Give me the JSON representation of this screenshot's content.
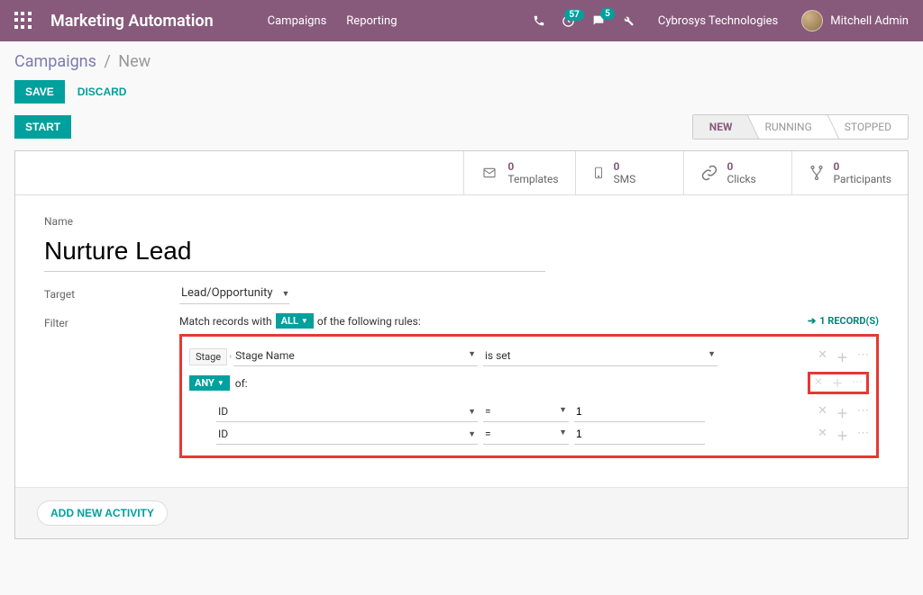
{
  "header": {
    "app_title": "Marketing Automation",
    "nav": {
      "campaigns": "Campaigns",
      "reporting": "Reporting"
    },
    "badges": {
      "activities": "57",
      "messages": "5"
    },
    "company": "Cybrosys Technologies",
    "user": "Mitchell Admin"
  },
  "breadcrumb": {
    "root": "Campaigns",
    "current": "New"
  },
  "buttons": {
    "save": "SAVE",
    "discard": "DISCARD",
    "start": "START"
  },
  "stages": {
    "new": "NEW",
    "running": "RUNNING",
    "stopped": "STOPPED"
  },
  "stats": {
    "templates": {
      "count": "0",
      "label": "Templates"
    },
    "sms": {
      "count": "0",
      "label": "SMS"
    },
    "clicks": {
      "count": "0",
      "label": "Clicks"
    },
    "participants": {
      "count": "0",
      "label": "Participants"
    }
  },
  "form": {
    "name_label": "Name",
    "name_value": "Nurture Lead",
    "target_label": "Target",
    "target_value": "Lead/Opportunity",
    "filter_label": "Filter"
  },
  "filter": {
    "match_pre": "Match records with",
    "all": "ALL",
    "match_post": "of the following rules:",
    "records": "1 RECORD(S)",
    "stage_field_part1": "Stage",
    "stage_field_part2": "Stage Name",
    "stage_op": "is set",
    "any": "ANY",
    "any_of": "of:",
    "sub": {
      "field": "ID",
      "op": "=",
      "value": "1"
    }
  },
  "footer": {
    "add_activity": "ADD NEW ACTIVITY"
  }
}
